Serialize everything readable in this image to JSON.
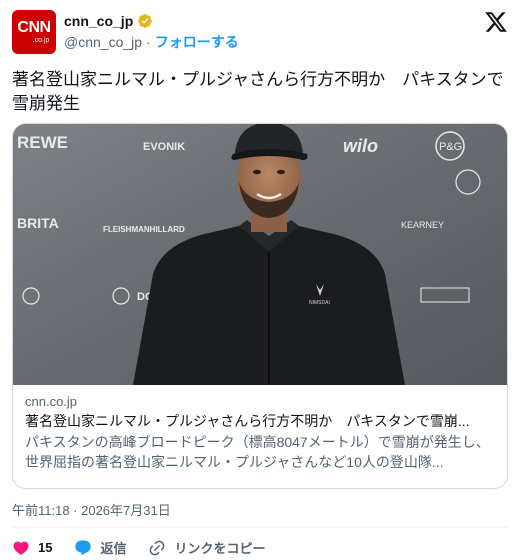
{
  "account": {
    "avatar_text": "CNN",
    "avatar_sub": ".co.jp",
    "display_name": "cnn_co_jp",
    "handle": "@cnn_co_jp",
    "separator": "·",
    "follow_label": "フォローする",
    "verified_color": "#e2b719"
  },
  "tweet": {
    "text": "著名登山家ニルマル・プルジャさんら行方不明か　パキスタンで雪崩発生"
  },
  "card": {
    "domain": "cnn.co.jp",
    "title": "著名登山家ニルマル・プルジャさんら行方不明か　パキスタンで雪崩...",
    "description": "パキスタンの高峰ブロードピーク（標高8047メートル）で雪崩が発生し、世界屈指の著名登山家ニルマル・プルジャさんなど10人の登山隊...",
    "image_logos": [
      "REWE",
      "EVONIK",
      "wilo",
      "P&G",
      "BRITA",
      "FLEISHMANHILLARD",
      "KEARNEY",
      "DGNB"
    ],
    "shirt_logo": "NIMSDAI"
  },
  "meta": {
    "timestamp": "午前11:18 · 2026年7月31日"
  },
  "actions": {
    "like_count": "15",
    "reply_label": "返信",
    "copy_link_label": "リンクをコピー"
  },
  "colors": {
    "accent": "#1d9bf0",
    "like": "#f91880",
    "brand": "#cc0000"
  }
}
